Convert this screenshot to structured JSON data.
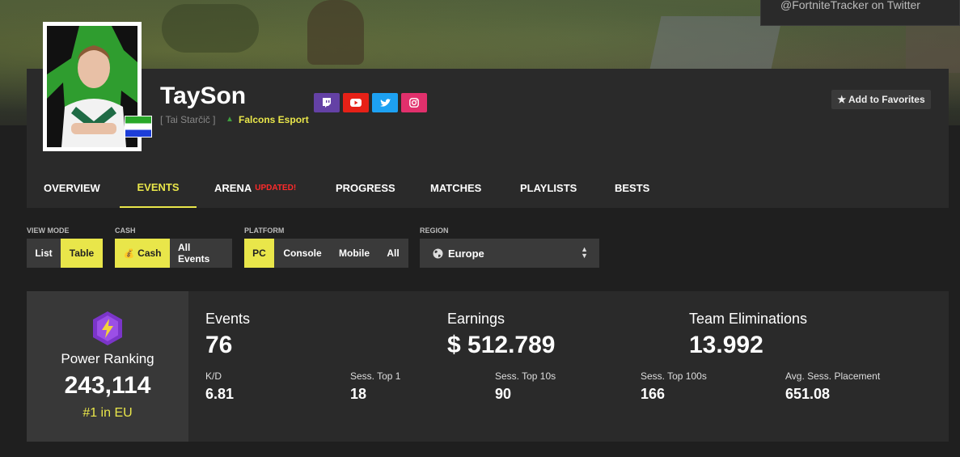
{
  "promo": {
    "text": "@FortniteTracker on Twitter"
  },
  "profile": {
    "name": "TaySon",
    "real_name": "[ Tai Starčič ]",
    "team": "Falcons Esport",
    "favorite_label": "★ Add to Favorites",
    "social": [
      {
        "name": "twitch",
        "color": "#6441a5"
      },
      {
        "name": "youtube",
        "color": "#e62117"
      },
      {
        "name": "twitter",
        "color": "#1da1f2"
      },
      {
        "name": "instagram",
        "color": "#e1306c"
      }
    ]
  },
  "tabs": [
    {
      "label": "OVERVIEW"
    },
    {
      "label": "EVENTS",
      "active": true
    },
    {
      "label": "ARENA",
      "badge": "UPDATED!"
    },
    {
      "label": "PROGRESS"
    },
    {
      "label": "MATCHES"
    },
    {
      "label": "PLAYLISTS"
    },
    {
      "label": "BESTS"
    }
  ],
  "filters": {
    "view_mode": {
      "label": "VIEW MODE",
      "options": [
        "List",
        "Table"
      ],
      "selected": "Table"
    },
    "cash": {
      "label": "CASH",
      "options": [
        "Cash",
        "All Events"
      ],
      "selected": "Cash"
    },
    "platform": {
      "label": "PLATFORM",
      "options": [
        "PC",
        "Console",
        "Mobile",
        "All"
      ],
      "selected": "PC"
    },
    "region": {
      "label": "REGION",
      "value": "Europe"
    }
  },
  "stats": {
    "power_ranking": {
      "label": "Power Ranking",
      "value": "243,114",
      "sub": "#1 in EU"
    },
    "events": {
      "label": "Events",
      "value": "76"
    },
    "earnings": {
      "label": "Earnings",
      "value": "$ 512.789"
    },
    "team_elims": {
      "label": "Team Eliminations",
      "value": "13.992"
    },
    "kd": {
      "label": "K/D",
      "value": "6.81"
    },
    "top1": {
      "label": "Sess. Top 1",
      "value": "18"
    },
    "top10": {
      "label": "Sess. Top 10s",
      "value": "90"
    },
    "top100": {
      "label": "Sess. Top 100s",
      "value": "166"
    },
    "avg_place": {
      "label": "Avg. Sess. Placement",
      "value": "651.08"
    }
  },
  "colors": {
    "accent": "#e9e64a",
    "panel": "#2a2a2a",
    "background": "#1f1f1f"
  }
}
